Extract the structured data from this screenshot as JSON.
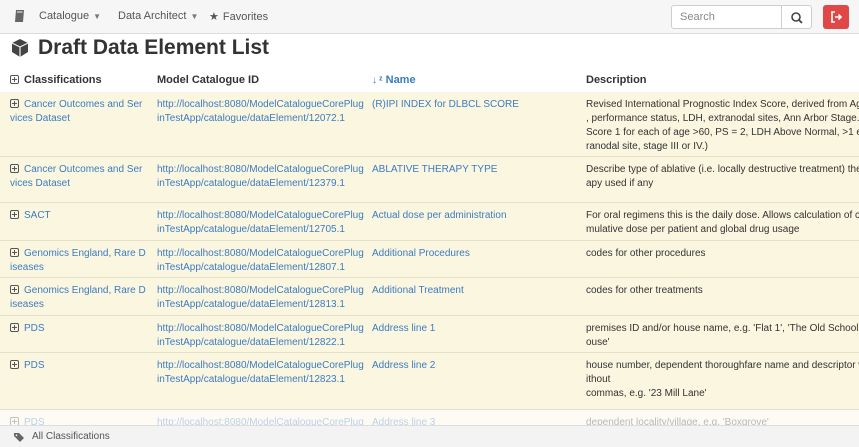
{
  "navbar": {
    "brand_icon": "book-icon",
    "catalogue": "Catalogue",
    "data_architect": "Data Architect",
    "favorites": "Favorites",
    "search_placeholder": "Search",
    "search_icon": "search-icon",
    "logout_icon": "sign-out-icon",
    "logout_color": "#e04848"
  },
  "page": {
    "title": "Draft Data Element List",
    "title_icon": "cube-icon"
  },
  "table": {
    "headers": {
      "classifications": "Classifications",
      "model_catalogue_id": "Model Catalogue ID",
      "name": "Name",
      "description": "Description"
    },
    "sort_icon": "sort-alpha-icon",
    "row_color": "#fbf6e0",
    "link_color": "#3b7cc1",
    "rows": [
      {
        "classification": [
          "Cancer Outcomes and Ser",
          "vices Dataset"
        ],
        "id": [
          "http://localhost:8080/ModelCatalogueCorePlug",
          "inTestApp/catalogue/dataElement/12072.1"
        ],
        "name": "(R)IPI INDEX for DLBCL SCORE",
        "description": [
          "Revised International Prognostic Index Score, derived from Age",
          ", performance status, LDH, extranodal sites, Ann Arbor Stage. (",
          "Score 1 for each of age >60, PS = 2, LDH Above Normal, >1 ext",
          "ranodal site, stage III or IV.)"
        ]
      },
      {
        "classification": [
          "Cancer Outcomes and Ser",
          "vices Dataset"
        ],
        "id": [
          "http://localhost:8080/ModelCatalogueCorePlug",
          "inTestApp/catalogue/dataElement/12379.1"
        ],
        "name": "ABLATIVE THERAPY TYPE",
        "description": [
          "Describe type of ablative (i.e. locally destructive treatment) ther",
          "apy used if any"
        ]
      },
      {
        "classification": [
          "SACT"
        ],
        "id": [
          "http://localhost:8080/ModelCatalogueCorePlug",
          "inTestApp/catalogue/dataElement/12705.1"
        ],
        "name": "Actual dose per administration",
        "description": [
          "For oral regimens this is the daily dose. Allows calculation of cu",
          "mulative dose per patient and global drug usage"
        ]
      },
      {
        "classification": [
          "Genomics England, Rare D",
          "iseases"
        ],
        "id": [
          "http://localhost:8080/ModelCatalogueCorePlug",
          "inTestApp/catalogue/dataElement/12807.1"
        ],
        "name": "Additional Procedures",
        "description": [
          "codes for other procedures"
        ]
      },
      {
        "classification": [
          "Genomics England, Rare D",
          "iseases"
        ],
        "id": [
          "http://localhost:8080/ModelCatalogueCorePlug",
          "inTestApp/catalogue/dataElement/12813.1"
        ],
        "name": "Additional Treatment",
        "description": [
          "codes for other treatments"
        ]
      },
      {
        "classification": [
          "PDS"
        ],
        "id": [
          "http://localhost:8080/ModelCatalogueCorePlug",
          "inTestApp/catalogue/dataElement/12822.1"
        ],
        "name": "Address line 1",
        "description": [
          "premises ID and/or house name, e.g. 'Flat 1', 'The Old Schoolh",
          "ouse'"
        ]
      },
      {
        "classification": [
          "PDS"
        ],
        "id": [
          "http://localhost:8080/ModelCatalogueCorePlug",
          "inTestApp/catalogue/dataElement/12823.1"
        ],
        "name": "Address line 2",
        "description": [
          "house number, dependent thoroughfare name and descriptor w",
          "ithout",
          "commas, e.g. '23 Mill Lane'"
        ]
      },
      {
        "classification": [
          "PDS"
        ],
        "id": [
          "http://localhost:8080/ModelCatalogueCorePlug"
        ],
        "name": "Address line 3",
        "description": [
          "dependent locality/village, e.g. 'Boxgrove'"
        ]
      }
    ]
  },
  "footer": {
    "label": "All Classifications",
    "icon": "tags-icon"
  }
}
